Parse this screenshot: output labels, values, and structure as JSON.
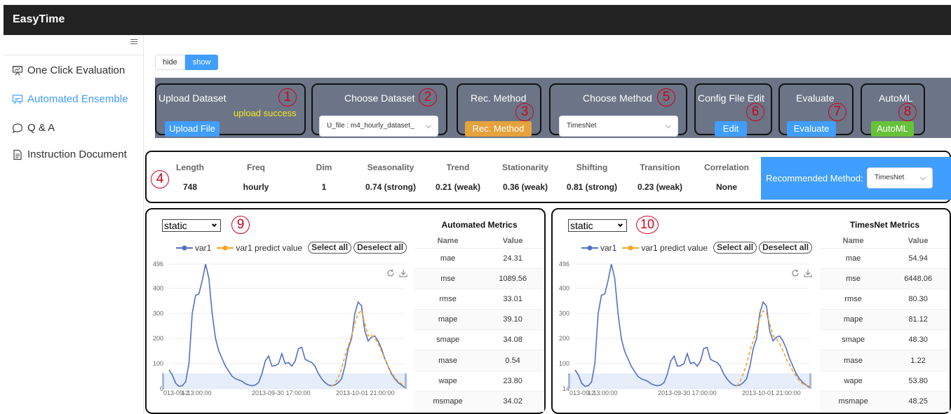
{
  "app": {
    "title": "EasyTime"
  },
  "sidebar": {
    "items": [
      {
        "label": "One Click Evaluation",
        "icon": "presentation-icon",
        "active": false
      },
      {
        "label": "Automated Ensemble",
        "icon": "chart-board-icon",
        "active": true
      },
      {
        "label": "Q & A",
        "icon": "chat-bubble-icon",
        "active": false
      },
      {
        "label": "Instruction Document",
        "icon": "document-icon",
        "active": false
      }
    ]
  },
  "view_toggle": {
    "hide": "hide",
    "show": "show",
    "selected": "show"
  },
  "toolbar": {
    "upload": {
      "title": "Upload Dataset",
      "status": "upload success",
      "button": "Upload File",
      "marker": "1"
    },
    "choose_dataset": {
      "title": "Choose Dataset",
      "value": "U_file : m4_hourly_dataset_",
      "marker": "2"
    },
    "rec_method": {
      "title": "Rec. Method",
      "button": "Rec. Method",
      "marker": "3"
    },
    "choose_method": {
      "title": "Choose Method",
      "value": "TimesNet",
      "marker": "5"
    },
    "config": {
      "title": "Config File Edit",
      "button": "Edit",
      "marker": "6"
    },
    "evaluate": {
      "title": "Evaluate",
      "button": "Evaluate",
      "marker": "7"
    },
    "automl": {
      "title": "AutoML",
      "button": "AutoML",
      "marker": "8"
    }
  },
  "stats": {
    "marker": "4",
    "columns": [
      {
        "name": "Length",
        "value": "748"
      },
      {
        "name": "Freq",
        "value": "hourly"
      },
      {
        "name": "Dim",
        "value": "1"
      },
      {
        "name": "Seasonality",
        "value": "0.74 (strong)"
      },
      {
        "name": "Trend",
        "value": "0.21 (weak)"
      },
      {
        "name": "Stationarity",
        "value": "0.36 (weak)"
      },
      {
        "name": "Shifting",
        "value": "0.81 (strong)"
      },
      {
        "name": "Transition",
        "value": "0.23 (weak)"
      },
      {
        "name": "Correlation",
        "value": "None"
      }
    ],
    "recommended_label": "Recommended Method:",
    "recommended_value": "TimesNet"
  },
  "colors": {
    "actual": "#5470c6",
    "predict": "#f5a623",
    "toolbar": "#6b7587",
    "primary": "#409eff",
    "orange": "#e6a23c",
    "green": "#67c23a",
    "marker": "#d0021b"
  },
  "legend": {
    "actual": "var1",
    "predict": "var1 predict value",
    "select_all": "Select all",
    "deselect_all": "Deselect all"
  },
  "panels": [
    {
      "marker": "9",
      "select": "static",
      "metrics_title": "Automated Metrics",
      "name_header": "Name",
      "value_header": "Value",
      "metrics": [
        {
          "name": "mae",
          "value": "24.31"
        },
        {
          "name": "mse",
          "value": "1089.56"
        },
        {
          "name": "rmse",
          "value": "33.01"
        },
        {
          "name": "mape",
          "value": "39.10"
        },
        {
          "name": "smape",
          "value": "34.08"
        },
        {
          "name": "mase",
          "value": "0.54"
        },
        {
          "name": "wape",
          "value": "23.80"
        },
        {
          "name": "msmape",
          "value": "34.02"
        }
      ]
    },
    {
      "marker": "10",
      "select": "static",
      "metrics_title": "TimesNet Metrics",
      "name_header": "Name",
      "value_header": "Value",
      "metrics": [
        {
          "name": "mae",
          "value": "54.94"
        },
        {
          "name": "mse",
          "value": "6448.06"
        },
        {
          "name": "rmse",
          "value": "80.30"
        },
        {
          "name": "mape",
          "value": "81.12"
        },
        {
          "name": "smape",
          "value": "48.30"
        },
        {
          "name": "mase",
          "value": "1.22"
        },
        {
          "name": "wape",
          "value": "53.80"
        },
        {
          "name": "msmape",
          "value": "48.25"
        }
      ]
    }
  ],
  "chart_data": [
    {
      "type": "line",
      "y_ticks": [
        0,
        100,
        200,
        300,
        400,
        496
      ],
      "ylim": [
        0,
        496
      ],
      "x_ticks": [
        "013-09-2",
        "1 13:00:00",
        "2013-09-30 17:00:00",
        "2013-10-01 21:00:00"
      ],
      "series": [
        {
          "name": "var1",
          "values": [
            75,
            55,
            22,
            10,
            12,
            28,
            100,
            300,
            372,
            377,
            430,
            496,
            440,
            300,
            200,
            150,
            120,
            90,
            70,
            50,
            40,
            35,
            30,
            20,
            15,
            12,
            15,
            25,
            60,
            110,
            130,
            90,
            92,
            100,
            140,
            100,
            105,
            90,
            110,
            160,
            165,
            118,
            110,
            105,
            90,
            60,
            40,
            25,
            15,
            12,
            15,
            25,
            40,
            90,
            160,
            200,
            300,
            345,
            330,
            230,
            190,
            205,
            210,
            190,
            160,
            120,
            90,
            60,
            40,
            25,
            15,
            5
          ]
        },
        {
          "name": "var1 predict value",
          "values": [
            null,
            null,
            null,
            null,
            null,
            null,
            null,
            null,
            null,
            null,
            null,
            null,
            null,
            null,
            null,
            null,
            null,
            null,
            null,
            null,
            null,
            null,
            null,
            null,
            null,
            null,
            null,
            null,
            null,
            null,
            null,
            null,
            null,
            null,
            null,
            null,
            null,
            null,
            null,
            null,
            null,
            null,
            null,
            null,
            null,
            null,
            null,
            null,
            null,
            10,
            20,
            45,
            80,
            130,
            170,
            210,
            260,
            300,
            310,
            260,
            210,
            215,
            200,
            180,
            150,
            120,
            90,
            65,
            45,
            30,
            20,
            10
          ]
        }
      ]
    },
    {
      "type": "line",
      "y_ticks": [
        14,
        100,
        200,
        300,
        400,
        496
      ],
      "ylim": [
        0,
        496
      ],
      "x_ticks": [
        "013-09-2",
        "1 13:00:00",
        "2013-09-30 17:00:00",
        "2013-10-01 21:00:00"
      ],
      "series": [
        {
          "name": "var1",
          "values": [
            75,
            55,
            22,
            10,
            12,
            28,
            100,
            300,
            372,
            377,
            430,
            496,
            440,
            300,
            200,
            150,
            120,
            90,
            70,
            50,
            40,
            35,
            30,
            20,
            15,
            12,
            15,
            25,
            60,
            110,
            130,
            90,
            92,
            100,
            140,
            100,
            105,
            90,
            110,
            160,
            165,
            118,
            110,
            105,
            90,
            60,
            40,
            25,
            15,
            12,
            15,
            25,
            40,
            90,
            160,
            200,
            300,
            345,
            330,
            230,
            190,
            205,
            210,
            190,
            160,
            120,
            90,
            60,
            40,
            25,
            15,
            5
          ]
        },
        {
          "name": "var1 predict value",
          "values": [
            null,
            null,
            null,
            null,
            null,
            null,
            null,
            null,
            null,
            null,
            null,
            null,
            null,
            null,
            null,
            null,
            null,
            null,
            null,
            null,
            null,
            null,
            null,
            null,
            null,
            null,
            null,
            null,
            null,
            null,
            null,
            null,
            null,
            null,
            null,
            null,
            null,
            null,
            null,
            null,
            null,
            null,
            null,
            null,
            null,
            null,
            null,
            null,
            null,
            10,
            30,
            60,
            100,
            150,
            190,
            235,
            280,
            310,
            300,
            260,
            210,
            200,
            180,
            150,
            120,
            95,
            70,
            50,
            30,
            20,
            15,
            10
          ]
        }
      ]
    }
  ]
}
